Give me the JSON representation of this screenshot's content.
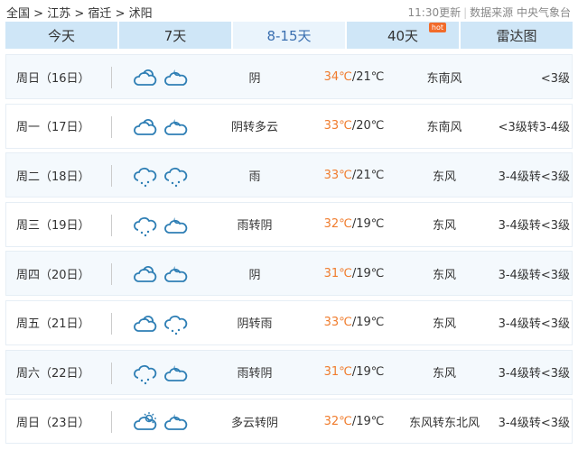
{
  "breadcrumb": [
    "全国",
    "江苏",
    "宿迁",
    "沭阳"
  ],
  "breadcrumb_sep": ">",
  "update_time": "11:30更新",
  "source": "数据来源 中央气象台",
  "tabs": [
    {
      "label": "今天"
    },
    {
      "label": "7天"
    },
    {
      "label": "8-15天",
      "active": true
    },
    {
      "label": "40天",
      "badge": "hot"
    },
    {
      "label": "雷达图"
    }
  ],
  "colors": {
    "icon": "#2f7fb5",
    "high_temp": "#f07c2d",
    "tab": "#cfe6f7"
  },
  "days": [
    {
      "date": "周日（16日）",
      "icons": [
        "cloudy",
        "moon-cloud"
      ],
      "cond": "阴",
      "high": "34℃",
      "low": "/21℃",
      "wind": "东南风",
      "level": "<3级"
    },
    {
      "date": "周一（17日）",
      "icons": [
        "cloudy",
        "moon-cloud"
      ],
      "cond": "阴转多云",
      "high": "33℃",
      "low": "/20℃",
      "wind": "东南风",
      "level": "<3级转3-4级"
    },
    {
      "date": "周二（18日）",
      "icons": [
        "rain",
        "rain"
      ],
      "cond": "雨",
      "high": "33℃",
      "low": "/21℃",
      "wind": "东风",
      "level": "3-4级转<3级"
    },
    {
      "date": "周三（19日）",
      "icons": [
        "rain",
        "moon-cloud"
      ],
      "cond": "雨转阴",
      "high": "32℃",
      "low": "/19℃",
      "wind": "东风",
      "level": "3-4级转<3级"
    },
    {
      "date": "周四（20日）",
      "icons": [
        "cloudy",
        "moon-cloud"
      ],
      "cond": "阴",
      "high": "31℃",
      "low": "/19℃",
      "wind": "东风",
      "level": "3-4级转<3级"
    },
    {
      "date": "周五（21日）",
      "icons": [
        "cloudy",
        "rain"
      ],
      "cond": "阴转雨",
      "high": "33℃",
      "low": "/19℃",
      "wind": "东风",
      "level": "3-4级转<3级"
    },
    {
      "date": "周六（22日）",
      "icons": [
        "rain",
        "moon-cloud"
      ],
      "cond": "雨转阴",
      "high": "31℃",
      "low": "/19℃",
      "wind": "东风",
      "level": "3-4级转<3级"
    },
    {
      "date": "周日（23日）",
      "icons": [
        "sun-cloud",
        "moon-cloud"
      ],
      "cond": "多云转阴",
      "high": "32℃",
      "low": "/19℃",
      "wind": "东风转东北风",
      "level": "3-4级转<3级"
    }
  ]
}
